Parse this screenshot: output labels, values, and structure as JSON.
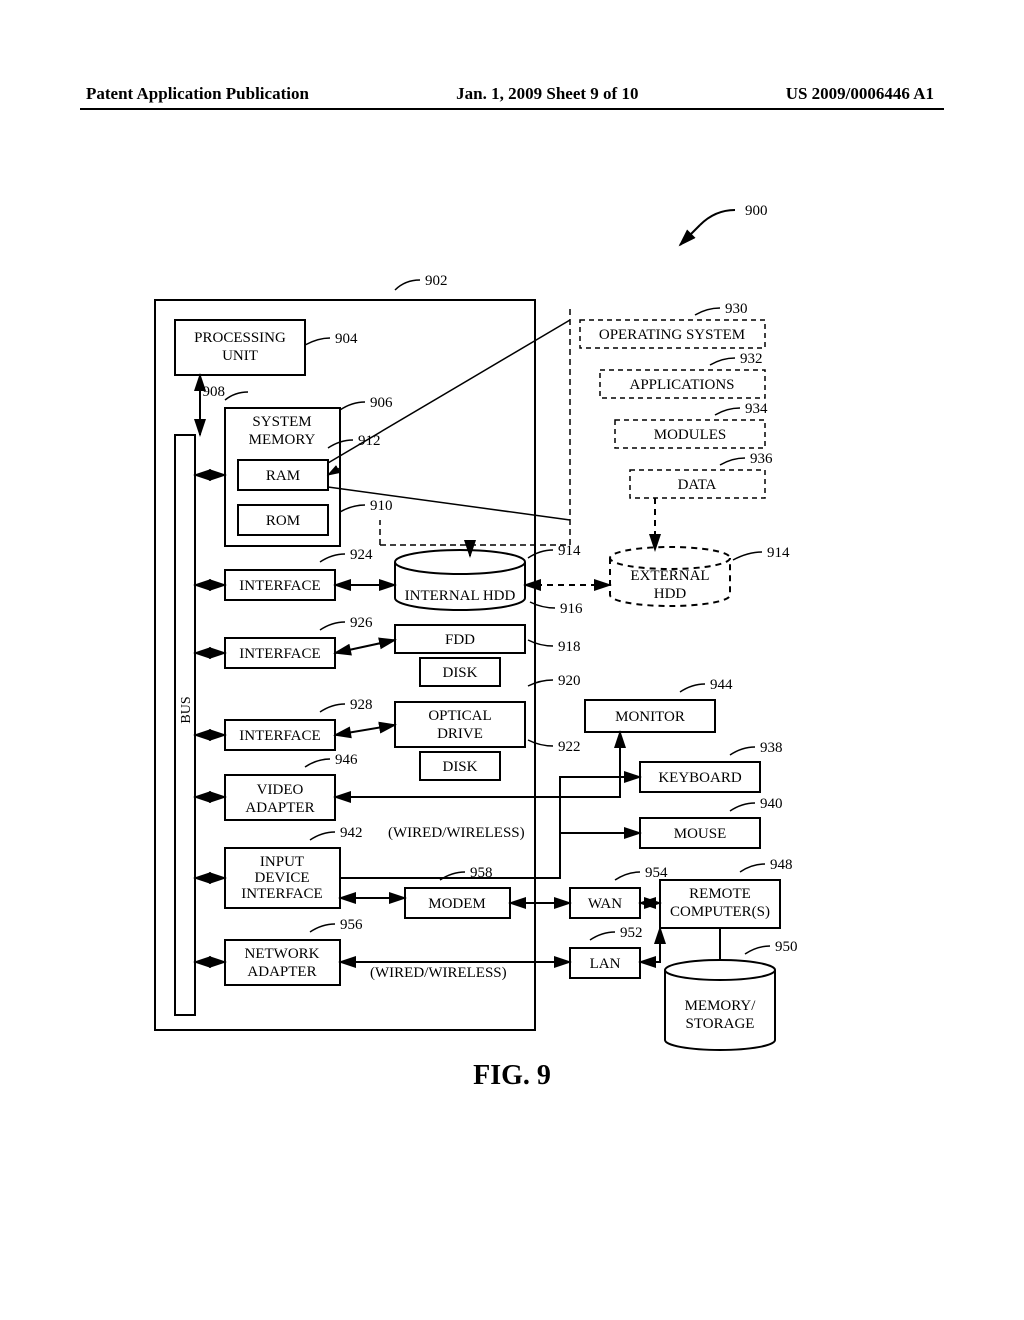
{
  "header": {
    "left": "Patent Application Publication",
    "center": "Jan. 1, 2009  Sheet 9 of 10",
    "right": "US 2009/0006446 A1"
  },
  "figure_title": "FIG. 9",
  "refs": {
    "n900": "900",
    "n902": "902",
    "n904": "904",
    "n906": "906",
    "n908": "908",
    "n910": "910",
    "n912": "912",
    "n914a": "914",
    "n914b": "914",
    "n916": "916",
    "n918": "918",
    "n920": "920",
    "n922": "922",
    "n924": "924",
    "n926": "926",
    "n928": "928",
    "n930": "930",
    "n932": "932",
    "n934": "934",
    "n936": "936",
    "n938": "938",
    "n940": "940",
    "n942": "942",
    "n944": "944",
    "n946": "946",
    "n948": "948",
    "n950": "950",
    "n952": "952",
    "n954": "954",
    "n956": "956",
    "n958": "958"
  },
  "blocks": {
    "processing_unit": "PROCESSING\nUNIT",
    "system_memory": "SYSTEM\nMEMORY",
    "ram": "RAM",
    "rom": "ROM",
    "bus": "BUS",
    "interface1": "INTERFACE",
    "interface2": "INTERFACE",
    "interface3": "INTERFACE",
    "video_adapter": "VIDEO\nADAPTER",
    "input_device_interface": "INPUT\nDEVICE\nINTERFACE",
    "modem": "MODEM",
    "network_adapter": "NETWORK\nADAPTER",
    "operating_system": "OPERATING SYSTEM",
    "applications": "APPLICATIONS",
    "modules": "MODULES",
    "data": "DATA",
    "internal_hdd": "INTERNAL HDD",
    "external_hdd": "EXTERNAL\nHDD",
    "fdd": "FDD",
    "disk1": "DISK",
    "optical_drive": "OPTICAL\nDRIVE",
    "disk2": "DISK",
    "monitor": "MONITOR",
    "keyboard": "KEYBOARD",
    "mouse": "MOUSE",
    "wan": "WAN",
    "lan": "LAN",
    "remote_computers": "REMOTE\nCOMPUTER(S)",
    "memory_storage": "MEMORY/\nSTORAGE",
    "wired_wireless1": "(WIRED/WIRELESS)",
    "wired_wireless2": "(WIRED/WIRELESS)"
  }
}
